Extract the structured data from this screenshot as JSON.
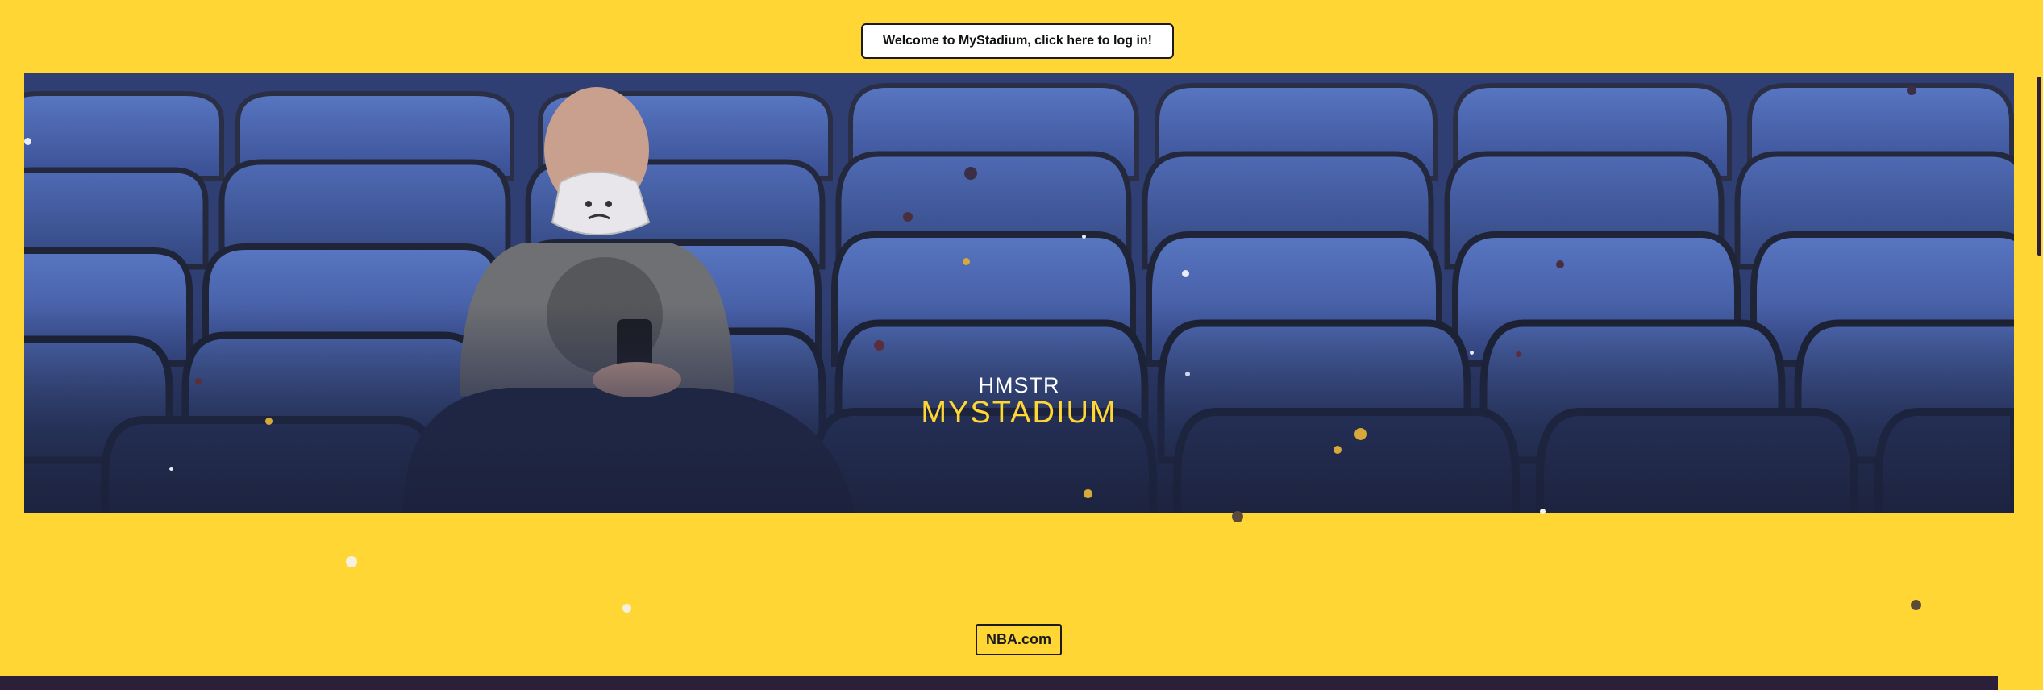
{
  "header": {
    "login_label": "Welcome to MyStadium, click here to log in!"
  },
  "hero": {
    "brand_top": "HMSTR",
    "brand_main": "MYSTADIUM",
    "image_description_icon": "stadium-seats-image"
  },
  "footer": {
    "link_label": "NBA.com"
  },
  "colors": {
    "background": "#ffd633",
    "accent": "#ffd633",
    "dark": "#2b1f3a",
    "seat_blue": "#4662a8"
  }
}
